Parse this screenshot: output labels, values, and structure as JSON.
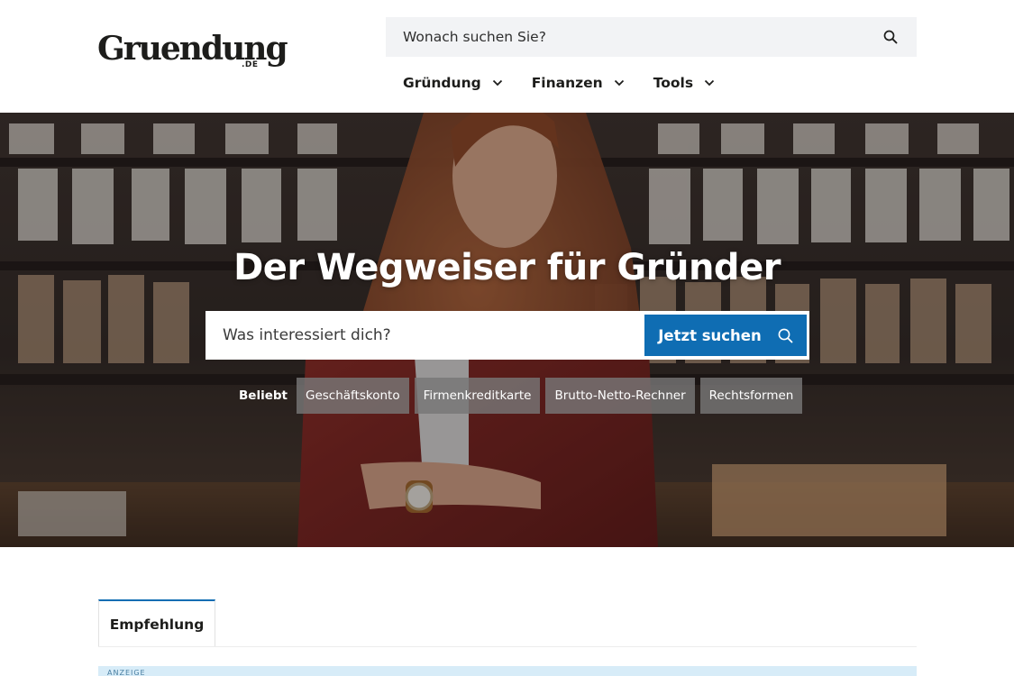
{
  "header": {
    "logo": {
      "word": "Gruendung",
      "tld": ".DE"
    },
    "search": {
      "placeholder": "Wonach suchen Sie?",
      "icon": "search-icon"
    },
    "nav": [
      {
        "label": "Gründung",
        "icon": "chevron-down-icon"
      },
      {
        "label": "Finanzen",
        "icon": "chevron-down-icon"
      },
      {
        "label": "Tools",
        "icon": "chevron-down-icon"
      }
    ]
  },
  "hero": {
    "title": "Der Wegweiser für Gründer",
    "search": {
      "placeholder": "Was interessiert dich?",
      "button_label": "Jetzt suchen",
      "button_icon": "search-icon"
    },
    "popular": {
      "label": "Beliebt",
      "chips": [
        "Geschäftskonto",
        "Firmenkreditkarte",
        "Brutto-Netto-Rechner",
        "Rechtsformen"
      ]
    }
  },
  "tabs": [
    {
      "label": "Empfehlung",
      "active": true
    }
  ],
  "ad": {
    "label": "ANZEIGE"
  },
  "colors": {
    "accent": "#0f6db3",
    "search_bg": "#f2f3f5",
    "chip_bg": "#787676",
    "ad_bg": "#d7ecf8",
    "text": "#1d1d1b"
  }
}
